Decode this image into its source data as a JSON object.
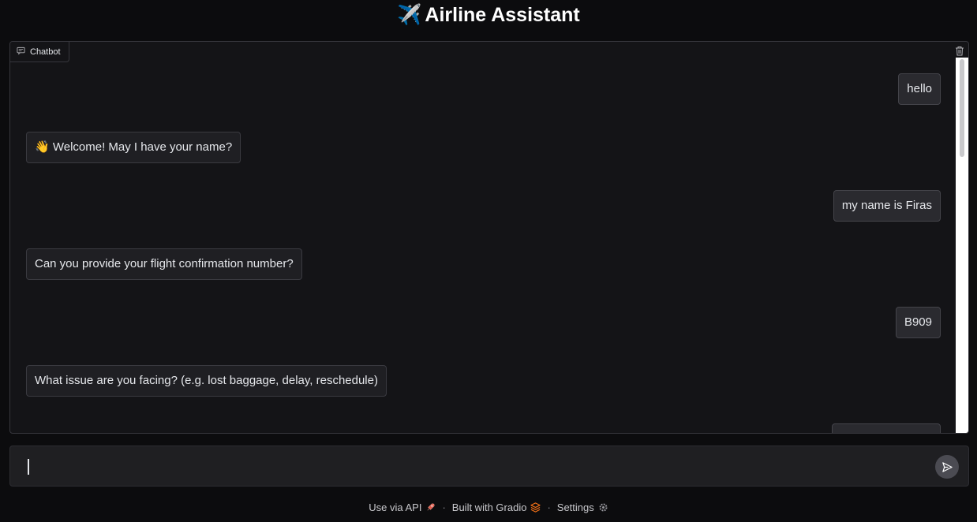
{
  "header": {
    "title": "Airline Assistant",
    "icon": "airplane-emoji",
    "icon_glyph": "✈️"
  },
  "chatbot": {
    "label": "Chatbot",
    "messages": [
      {
        "role": "user",
        "text": "hello"
      },
      {
        "role": "bot",
        "text": "👋 Welcome! May I have your name?"
      },
      {
        "role": "user",
        "text": "my name is Firas"
      },
      {
        "role": "bot",
        "text": "Can you provide your flight confirmation number?"
      },
      {
        "role": "user",
        "text": "B909"
      },
      {
        "role": "bot",
        "text": "What issue are you facing? (e.g. lost baggage, delay, reschedule)"
      },
      {
        "role": "user",
        "text": ""
      }
    ]
  },
  "input": {
    "value": "",
    "placeholder": ""
  },
  "footer": {
    "api_label": "Use via API",
    "gradio_label": "Built with Gradio",
    "settings_label": "Settings",
    "separator": "·"
  },
  "colors": {
    "background": "#0c0c0e",
    "panel": "#141417",
    "bubble_border": "#3a3a40",
    "accent_orange": "#f97316"
  }
}
